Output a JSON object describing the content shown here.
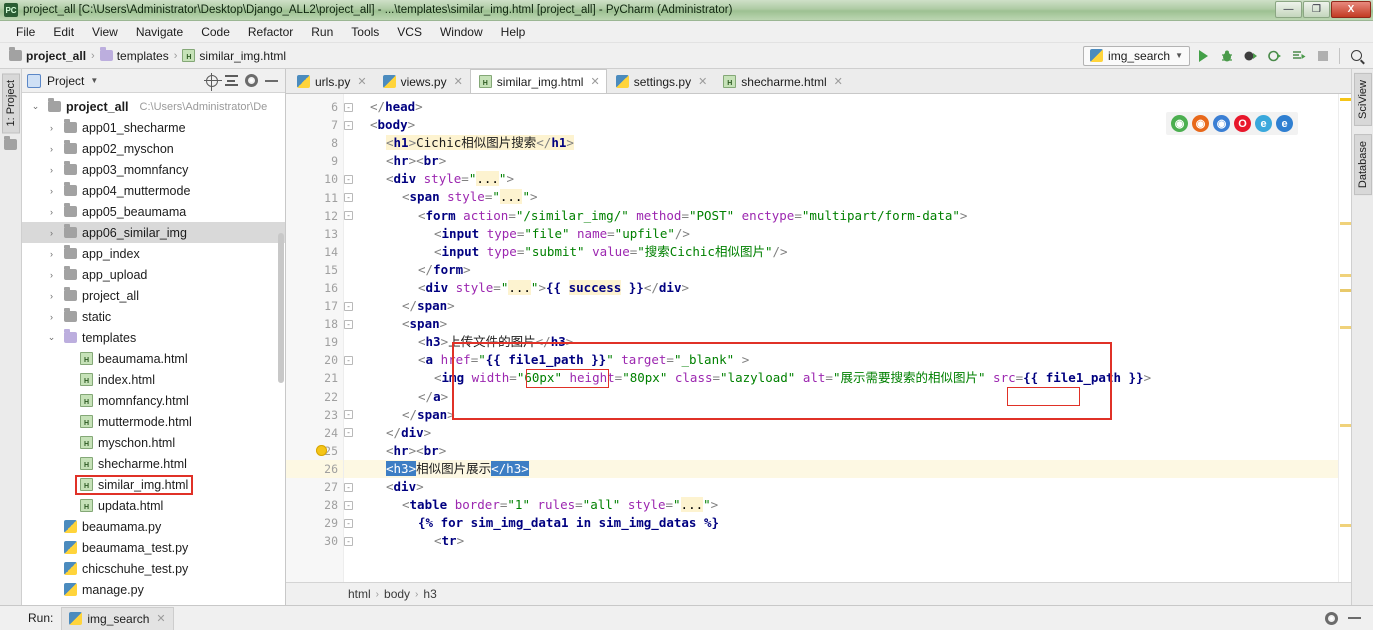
{
  "window": {
    "title": "project_all [C:\\Users\\Administrator\\Desktop\\Django_ALL2\\project_all] - ...\\templates\\similar_img.html [project_all] - PyCharm (Administrator)",
    "app_icon": "PC",
    "minimize": "—",
    "maximize": "❐",
    "close": "X"
  },
  "menu": {
    "items": [
      "File",
      "Edit",
      "View",
      "Navigate",
      "Code",
      "Refactor",
      "Run",
      "Tools",
      "VCS",
      "Window",
      "Help"
    ]
  },
  "navbar": {
    "breadcrumbs": [
      {
        "label": "project_all",
        "icon": "folder-icon"
      },
      {
        "label": "templates",
        "icon": "folder-purple-icon"
      },
      {
        "label": "similar_img.html",
        "icon": "html-file-icon"
      }
    ],
    "separator": "›",
    "run_config": {
      "label": "img_search",
      "chevron": "▼"
    },
    "buttons": [
      {
        "name": "run-button",
        "glyph": "▶"
      },
      {
        "name": "debug-button",
        "glyph": "🐞"
      },
      {
        "name": "run-with-coverage-button",
        "glyph": "▶"
      },
      {
        "name": "profile-button",
        "glyph": "◔"
      },
      {
        "name": "run-to-cursor-button",
        "glyph": "⇥"
      },
      {
        "name": "stop-button",
        "glyph": "■"
      },
      {
        "name": "search-everywhere-button",
        "glyph": "🔍"
      }
    ]
  },
  "left_strip": {
    "tab": "1: Project"
  },
  "project_panel": {
    "title": "Project",
    "chevron": "▼",
    "header_buttons": [
      "target-icon",
      "collapse-all-icon",
      "settings-icon",
      "hide-icon"
    ],
    "tree": [
      {
        "label": "project_all",
        "path": "C:\\Users\\Administrator\\De",
        "icon": "folder-icon",
        "arrow": "⌄",
        "indent": 0,
        "bold": true,
        "selected": false
      },
      {
        "label": "app01_shecharme",
        "icon": "folder-icon",
        "arrow": "›",
        "indent": 1,
        "selected": false
      },
      {
        "label": "app02_myschon",
        "icon": "folder-icon",
        "arrow": "›",
        "indent": 1,
        "selected": false
      },
      {
        "label": "app03_momnfancy",
        "icon": "folder-icon",
        "arrow": "›",
        "indent": 1,
        "selected": false
      },
      {
        "label": "app04_muttermode",
        "icon": "folder-icon",
        "arrow": "›",
        "indent": 1,
        "selected": false
      },
      {
        "label": "app05_beaumama",
        "icon": "folder-icon",
        "arrow": "›",
        "indent": 1,
        "selected": false
      },
      {
        "label": "app06_similar_img",
        "icon": "folder-icon",
        "arrow": "›",
        "indent": 1,
        "selected": true
      },
      {
        "label": "app_index",
        "icon": "folder-icon",
        "arrow": "›",
        "indent": 1,
        "selected": false
      },
      {
        "label": "app_upload",
        "icon": "folder-icon",
        "arrow": "›",
        "indent": 1,
        "selected": false
      },
      {
        "label": "project_all",
        "icon": "folder-icon",
        "arrow": "›",
        "indent": 1,
        "selected": false
      },
      {
        "label": "static",
        "icon": "folder-icon",
        "arrow": "›",
        "indent": 1,
        "selected": false
      },
      {
        "label": "templates",
        "icon": "folder-purple-icon",
        "arrow": "⌄",
        "indent": 1,
        "selected": false
      },
      {
        "label": "beaumama.html",
        "icon": "html-file-icon",
        "arrow": "",
        "indent": 2,
        "selected": false
      },
      {
        "label": "index.html",
        "icon": "html-file-icon",
        "arrow": "",
        "indent": 2,
        "selected": false
      },
      {
        "label": "momnfancy.html",
        "icon": "html-file-icon",
        "arrow": "",
        "indent": 2,
        "selected": false
      },
      {
        "label": "muttermode.html",
        "icon": "html-file-icon",
        "arrow": "",
        "indent": 2,
        "selected": false
      },
      {
        "label": "myschon.html",
        "icon": "html-file-icon",
        "arrow": "",
        "indent": 2,
        "selected": false
      },
      {
        "label": "shecharme.html",
        "icon": "html-file-icon",
        "arrow": "",
        "indent": 2,
        "selected": false
      },
      {
        "label": "similar_img.html",
        "icon": "html-file-icon",
        "arrow": "",
        "indent": 2,
        "selected": false,
        "annotated": true
      },
      {
        "label": "updata.html",
        "icon": "html-file-icon",
        "arrow": "",
        "indent": 2,
        "selected": false
      },
      {
        "label": "beaumama.py",
        "icon": "python-file-icon",
        "arrow": "",
        "indent": 1,
        "selected": false
      },
      {
        "label": "beaumama_test.py",
        "icon": "python-file-icon",
        "arrow": "",
        "indent": 1,
        "selected": false
      },
      {
        "label": "chicschuhe_test.py",
        "icon": "python-file-icon",
        "arrow": "",
        "indent": 1,
        "selected": false
      },
      {
        "label": "manage.py",
        "icon": "python-file-icon",
        "arrow": "",
        "indent": 1,
        "selected": false
      }
    ]
  },
  "editor": {
    "tabs": [
      {
        "label": "urls.py",
        "icon": "python-file-icon",
        "active": false,
        "close": "✕"
      },
      {
        "label": "views.py",
        "icon": "python-file-icon",
        "active": false,
        "close": "✕"
      },
      {
        "label": "similar_img.html",
        "icon": "html-file-icon",
        "active": true,
        "close": "✕"
      },
      {
        "label": "settings.py",
        "icon": "python-file-icon",
        "active": false,
        "close": "✕"
      },
      {
        "label": "shecharme.html",
        "icon": "html-file-icon",
        "active": false,
        "close": "✕"
      }
    ],
    "first_line": 6,
    "lines": [
      {
        "n": 6,
        "fold": "-",
        "indent": 1,
        "html": "<span class='t-brk'>&lt;/</span><span class='t-tag'>head</span><span class='t-brk'>&gt;</span>"
      },
      {
        "n": 7,
        "fold": "-",
        "indent": 1,
        "html": "<span class='t-brk'>&lt;</span><span class='t-tag'>body</span><span class='t-brk'>&gt;</span>"
      },
      {
        "n": 8,
        "fold": "",
        "indent": 2,
        "html": "<span class='hl-y'><span class='t-brk'>&lt;</span><span class='t-tag'>h1</span><span class='t-brk'>&gt;</span><span class='t-txt'>Cichic相似图片搜索</span><span class='t-brk'>&lt;/</span><span class='t-tag'>h1</span><span class='t-brk'>&gt;</span></span>"
      },
      {
        "n": 9,
        "fold": "",
        "indent": 2,
        "html": "<span class='t-brk'>&lt;</span><span class='t-tag'>hr</span><span class='t-brk'>&gt;&lt;</span><span class='t-tag'>br</span><span class='t-brk'>&gt;</span>"
      },
      {
        "n": 10,
        "fold": "-",
        "indent": 2,
        "html": "<span class='t-brk'>&lt;</span><span class='t-tag'>div</span> <span class='t-attr'>style</span><span class='t-brk'>=</span><span class='t-str'>\"</span><span class='hl-y'>...</span><span class='t-str'>\"</span><span class='t-brk'>&gt;</span>"
      },
      {
        "n": 11,
        "fold": "-",
        "indent": 3,
        "html": "<span class='t-brk'>&lt;</span><span class='t-tag'>span</span> <span class='t-attr'>style</span><span class='t-brk'>=</span><span class='t-str'>\"</span><span class='hl-y'>...</span><span class='t-str'>\"</span><span class='t-brk'>&gt;</span>"
      },
      {
        "n": 12,
        "fold": "-",
        "indent": 4,
        "html": "<span class='t-brk'>&lt;</span><span class='t-tag'>form</span> <span class='t-attr'>action</span><span class='t-brk'>=</span><span class='t-str'>\"/similar_img/\"</span> <span class='t-attr'>method</span><span class='t-brk'>=</span><span class='t-str'>\"POST\"</span> <span class='t-attr'>enctype</span><span class='t-brk'>=</span><span class='t-str'>\"multipart/form-data\"</span><span class='t-brk'>&gt;</span>"
      },
      {
        "n": 13,
        "fold": "",
        "indent": 5,
        "html": "<span class='t-brk'>&lt;</span><span class='t-tag'>input</span> <span class='t-attr'>type</span><span class='t-brk'>=</span><span class='t-str'>\"file\"</span> <span class='t-attr'>name</span><span class='t-brk'>=</span><span class='t-str'>\"upfile\"</span><span class='t-brk'>/&gt;</span>"
      },
      {
        "n": 14,
        "fold": "",
        "indent": 5,
        "html": "<span class='t-brk'>&lt;</span><span class='t-tag'>input</span> <span class='t-attr'>type</span><span class='t-brk'>=</span><span class='t-str'>\"submit\"</span> <span class='t-attr'>value</span><span class='t-brk'>=</span><span class='t-str'>\"搜索Cichic相似图片\"</span><span class='t-brk'>/&gt;</span>"
      },
      {
        "n": 15,
        "fold": "",
        "indent": 4,
        "html": "<span class='t-brk'>&lt;/</span><span class='t-tag'>form</span><span class='t-brk'>&gt;</span>"
      },
      {
        "n": 16,
        "fold": "",
        "indent": 4,
        "html": "<span class='t-brk'>&lt;</span><span class='t-tag'>div</span> <span class='t-attr'>style</span><span class='t-brk'>=</span><span class='t-str'>\"</span><span class='hl-y'>...</span><span class='t-str'>\"</span><span class='t-brk'>&gt;</span><span class='t-dj'>{{ </span><span class='hl-y'><span class='t-dj'>success</span></span><span class='t-dj'> }}</span><span class='t-brk'>&lt;/</span><span class='t-tag'>div</span><span class='t-brk'>&gt;</span>"
      },
      {
        "n": 17,
        "fold": "-",
        "indent": 3,
        "html": "<span class='t-brk'>&lt;/</span><span class='t-tag'>span</span><span class='t-brk'>&gt;</span>"
      },
      {
        "n": 18,
        "fold": "-",
        "indent": 3,
        "html": "<span class='t-brk'>&lt;</span><span class='t-tag'>span</span><span class='t-brk'>&gt;</span>"
      },
      {
        "n": 19,
        "fold": "",
        "indent": 4,
        "html": "<span class='t-brk'>&lt;</span><span class='t-tag'>h3</span><span class='t-brk'>&gt;</span><span class='t-txt'>上传文件的图片</span><span class='t-brk'>&lt;/</span><span class='t-tag'>h3</span><span class='t-brk'>&gt;</span>"
      },
      {
        "n": 20,
        "fold": "-",
        "indent": 4,
        "html": "<span class='t-brk'>&lt;</span><span class='t-tag'>a</span> <span class='t-attr'>href</span><span class='t-brk'>=</span><span class='t-str'>\"</span><span class='t-dj'>{{ file1_path }}</span><span class='t-str'>\"</span> <span class='t-attr'>target</span><span class='t-brk'>=</span><span class='t-str'>\"_blank\"</span> <span class='t-brk'>&gt;</span>"
      },
      {
        "n": 21,
        "fold": "",
        "indent": 5,
        "html": "<span class='t-brk'>&lt;</span><span class='t-tag'>img</span> <span class='t-attr'>width</span><span class='t-brk'>=</span><span class='t-str'>\"60px\"</span> <span class='t-attr'>height</span><span class='t-brk'>=</span><span class='t-str'>\"80px\"</span> <span class='t-attr'>class</span><span class='t-brk'>=</span><span class='t-str'>\"lazyload\"</span> <span class='t-attr'>alt</span><span class='t-brk'>=</span><span class='t-str'>\"展示需要搜索的相似图片\"</span> <span class='t-attr'>src</span><span class='t-brk'>=</span><span class='t-dj'>{{ file1_path }}</span><span class='t-brk'>&gt;</span>"
      },
      {
        "n": 22,
        "fold": "",
        "indent": 4,
        "html": "<span class='t-brk'>&lt;/</span><span class='t-tag'>a</span><span class='t-brk'>&gt;</span>"
      },
      {
        "n": 23,
        "fold": "-",
        "indent": 3,
        "html": "<span class='t-brk'>&lt;/</span><span class='t-tag'>span</span><span class='t-brk'>&gt;</span>"
      },
      {
        "n": 24,
        "fold": "-",
        "indent": 2,
        "html": "<span class='t-brk'>&lt;/</span><span class='t-tag'>div</span><span class='t-brk'>&gt;</span>"
      },
      {
        "n": 25,
        "fold": "",
        "indent": 2,
        "bulb": true,
        "html": "<span class='t-brk'>&lt;</span><span class='t-tag'>hr</span><span class='t-brk'>&gt;&lt;</span><span class='t-tag'>br</span><span class='t-brk'>&gt;</span>"
      },
      {
        "n": 26,
        "fold": "",
        "indent": 2,
        "current": true,
        "html": "<span class='hl-blue'>&lt;h3&gt;</span><span class='t-txt'>相似图片展示</span><span class='hl-blue'>&lt;/h3&gt;</span>"
      },
      {
        "n": 27,
        "fold": "-",
        "indent": 2,
        "html": "<span class='t-brk'>&lt;</span><span class='t-tag'>div</span><span class='t-brk'>&gt;</span>"
      },
      {
        "n": 28,
        "fold": "-",
        "indent": 3,
        "html": "<span class='t-brk'>&lt;</span><span class='t-tag'>table</span> <span class='t-attr'>border</span><span class='t-brk'>=</span><span class='t-str'>\"1\"</span> <span class='t-attr'>rules</span><span class='t-brk'>=</span><span class='t-str'>\"all\"</span> <span class='t-attr'>style</span><span class='t-brk'>=</span><span class='t-str'>\"</span><span class='hl-y'>...</span><span class='t-str'>\"</span><span class='t-brk'>&gt;</span>"
      },
      {
        "n": 29,
        "fold": "-",
        "indent": 4,
        "html": "<span class='t-dj'>{% for sim_img_data1 in sim_img_datas %}</span>"
      },
      {
        "n": 30,
        "fold": "-",
        "indent": 5,
        "html": "<span class='t-brk'>&lt;</span><span class='t-tag'>tr</span><span class='t-brk'>&gt;</span>"
      }
    ],
    "browser_icons": [
      {
        "name": "chrome-icon",
        "glyph": "◉",
        "color": "#4caf50"
      },
      {
        "name": "firefox-icon",
        "glyph": "◉",
        "color": "#e8681a"
      },
      {
        "name": "safari-icon",
        "glyph": "◉",
        "color": "#3b7fd4"
      },
      {
        "name": "opera-icon",
        "glyph": "O",
        "color": "#e8172b"
      },
      {
        "name": "internet-explorer-icon",
        "glyph": "e",
        "color": "#3aa8dc"
      },
      {
        "name": "edge-icon",
        "glyph": "e",
        "color": "#2f7fd1"
      }
    ]
  },
  "right_strip": {
    "tabs": [
      "SciView",
      "Database"
    ]
  },
  "breadcrumb_bar": {
    "items": [
      "html",
      "body",
      "h3"
    ],
    "separator": "›"
  },
  "run_panel": {
    "label": "Run:",
    "tab": {
      "label": "img_search",
      "close": "✕",
      "icon": "python-file-icon"
    },
    "right_buttons": [
      "settings-icon",
      "hide-icon"
    ]
  }
}
